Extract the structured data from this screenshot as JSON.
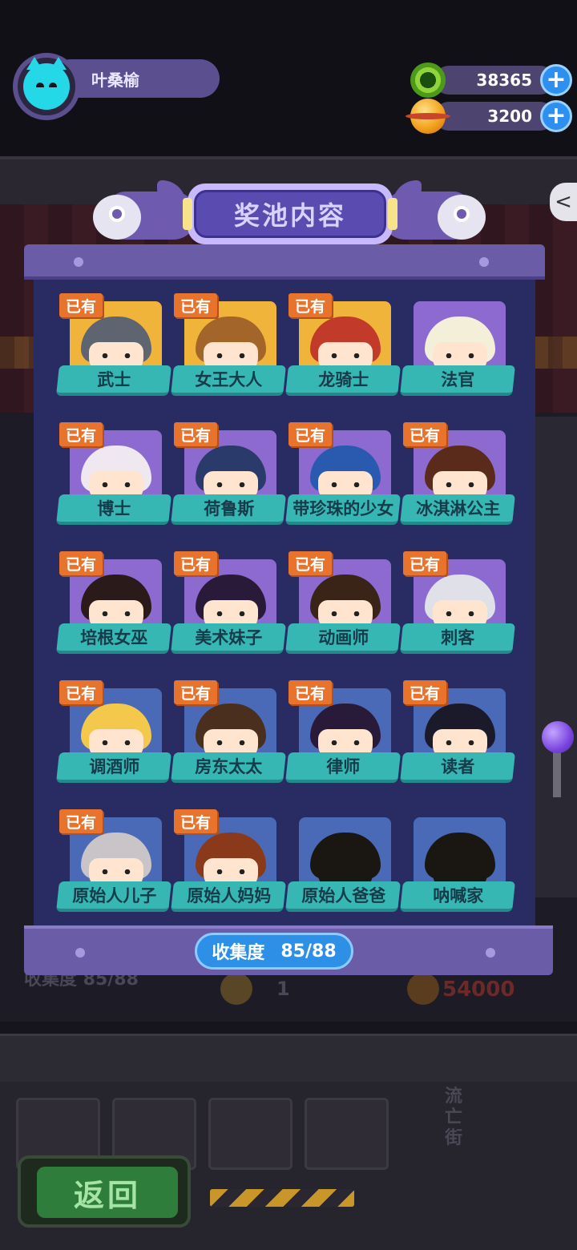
{
  "player": {
    "name": "叶桑榆",
    "avatar_icon": "cat-avatar-icon"
  },
  "currency": {
    "green": {
      "icon": "green-gem-icon",
      "value": "38365"
    },
    "gold": {
      "icon": "gold-planet-icon",
      "value": "3200"
    },
    "plus_label": "+"
  },
  "panel": {
    "title": "奖池内容",
    "owned_badge": "已有",
    "collection_label": "收集度",
    "collection_value": "85/88"
  },
  "characters": [
    {
      "name": "武士",
      "owned": true,
      "bg": "gold",
      "hair": "#5e6470",
      "outfit": "#3a3e4a"
    },
    {
      "name": "女王大人",
      "owned": true,
      "bg": "gold",
      "hair": "#a3652a",
      "outfit": "#e04a3a"
    },
    {
      "name": "龙骑士",
      "owned": true,
      "bg": "gold",
      "hair": "#c23a2a",
      "outfit": "#2a3a4a"
    },
    {
      "name": "法官",
      "owned": false,
      "bg": "purple",
      "hair": "#f4efd8",
      "outfit": "#1a1a2a"
    },
    {
      "name": "博士",
      "owned": true,
      "bg": "purple",
      "hair": "#f0e8f0",
      "outfit": "#d98a30"
    },
    {
      "name": "荷鲁斯",
      "owned": true,
      "bg": "purple",
      "hair": "#2a3a6a",
      "outfit": "#c83a2a"
    },
    {
      "name": "带珍珠的少女",
      "owned": true,
      "bg": "purple",
      "hair": "#2a5ab0",
      "outfit": "#6a4a2a"
    },
    {
      "name": "冰淇淋公主",
      "owned": true,
      "bg": "purple",
      "hair": "#5a2a1a",
      "outfit": "#e04a6a"
    },
    {
      "name": "培根女巫",
      "owned": true,
      "bg": "purple",
      "hair": "#2a1a1a",
      "outfit": "#f4e0c0"
    },
    {
      "name": "美术妹子",
      "owned": true,
      "bg": "purple",
      "hair": "#2a1a3a",
      "outfit": "#d0c8e8"
    },
    {
      "name": "动画师",
      "owned": true,
      "bg": "purple",
      "hair": "#3a2418",
      "outfit": "#3a6a4a"
    },
    {
      "name": "刺客",
      "owned": true,
      "bg": "purple",
      "hair": "#e0e0e8",
      "outfit": "#8a8aa0"
    },
    {
      "name": "调酒师",
      "owned": true,
      "bg": "blue",
      "hair": "#f4c84a",
      "outfit": "#e8e0d0"
    },
    {
      "name": "房东太太",
      "owned": true,
      "bg": "blue",
      "hair": "#4a2e1e",
      "outfit": "#e8d0b0"
    },
    {
      "name": "律师",
      "owned": true,
      "bg": "blue",
      "hair": "#2a1a3a",
      "outfit": "#1a1a2a"
    },
    {
      "name": "读者",
      "owned": true,
      "bg": "blue",
      "hair": "#1a1a2a",
      "outfit": "#e0d8e8"
    },
    {
      "name": "原始人儿子",
      "owned": true,
      "bg": "blue",
      "hair": "#c8c4c8",
      "outfit": "#8a5a3a"
    },
    {
      "name": "原始人妈妈",
      "owned": true,
      "bg": "blue",
      "hair": "#8a3a1a",
      "outfit": "#c87a3a"
    },
    {
      "name": "原始人爸爸",
      "owned": false,
      "bg": "blue",
      "hair": "#1a1612",
      "outfit": "#1a1612",
      "silhouette": true
    },
    {
      "name": "呐喊家",
      "owned": false,
      "bg": "blue",
      "hair": "#1a1612",
      "outfit": "#1a1612",
      "silhouette": true
    }
  ],
  "back_button": {
    "label": "返回"
  },
  "background": {
    "ghost_collection": "收集度  85/88",
    "ghost_count": "1",
    "ghost_price": "54000",
    "ghost_sign": "流亡街"
  }
}
